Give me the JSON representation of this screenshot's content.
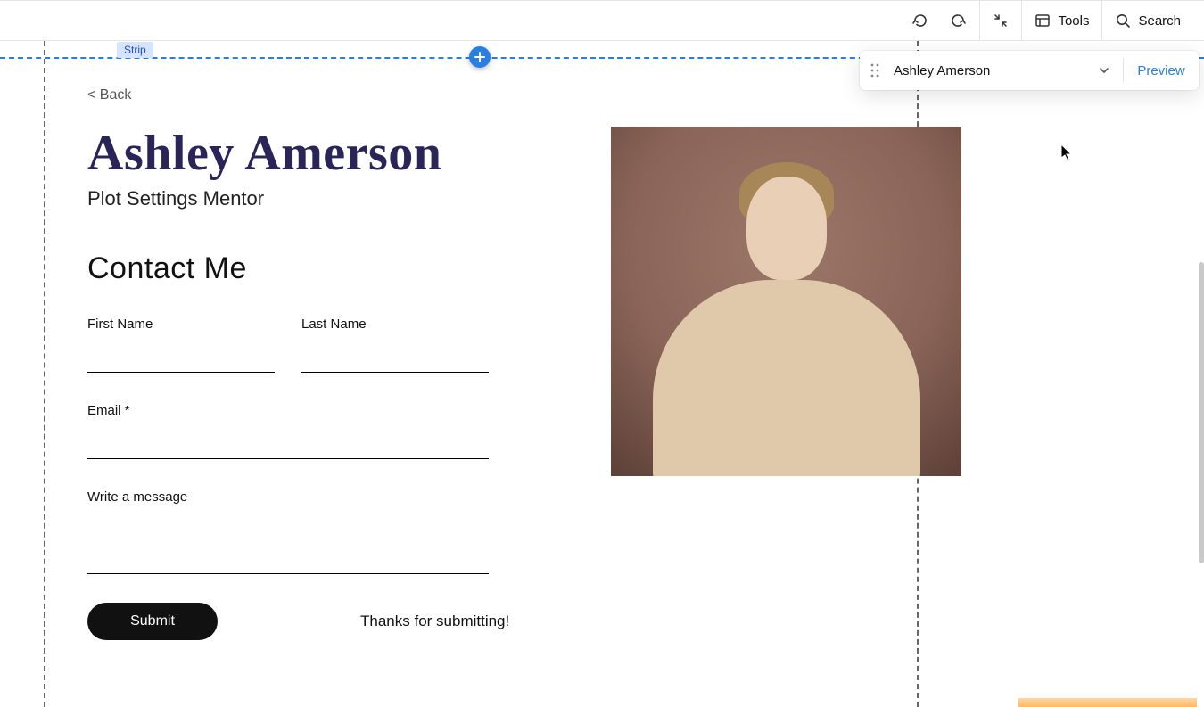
{
  "topbar": {
    "tools_label": "Tools",
    "search_label": "Search"
  },
  "pagepanel": {
    "page_name": "Ashley Amerson",
    "preview_label": "Preview"
  },
  "strip_tag_label": "Strip",
  "page": {
    "back_label": "< Back",
    "title": "Ashley Amerson",
    "subtitle": "Plot Settings Mentor",
    "contact_heading": "Contact Me",
    "form": {
      "first_name_label": "First Name",
      "last_name_label": "Last Name",
      "email_label": "Email *",
      "message_label": "Write a message",
      "submit_label": "Submit",
      "thanks_text": "Thanks for submitting!"
    }
  }
}
